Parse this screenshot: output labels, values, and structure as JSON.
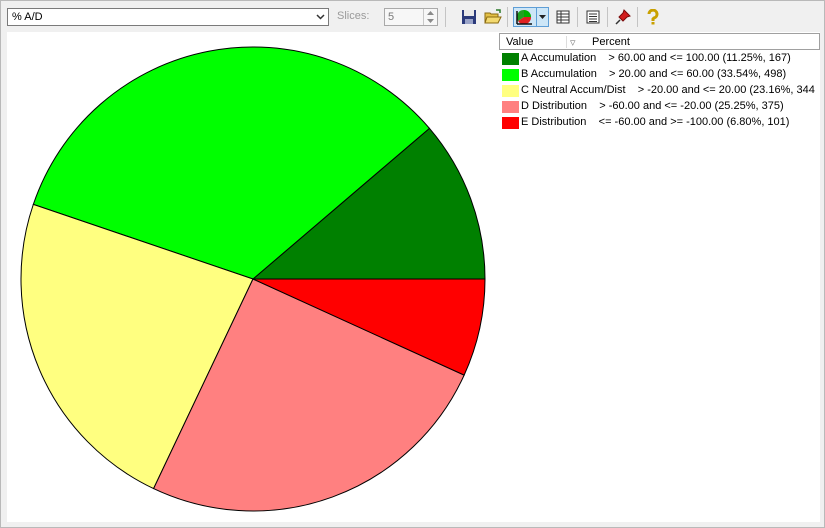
{
  "toolbar": {
    "indicator_select": "% A/D",
    "slices_label": "Slices:",
    "slices_value": "5",
    "icons": [
      "save-icon",
      "open-folder-icon",
      "pie-chart-icon",
      "dropdown-arrow-icon",
      "table-view-icon",
      "list-view-icon",
      "pin-icon",
      "help-icon"
    ]
  },
  "legend": {
    "header_value": "Value",
    "header_percent": "Percent"
  },
  "chart_data": {
    "type": "pie",
    "slices": [
      {
        "label": "A Accumulation",
        "range": "> 60.00 and <= 100.00",
        "percent": 11.25,
        "count": 167,
        "color": "#008000",
        "text": "A Accumulation    > 60.00 and <= 100.00 (11.25%, 167)"
      },
      {
        "label": "B Accumulation",
        "range": "> 20.00 and <= 60.00",
        "percent": 33.54,
        "count": 498,
        "color": "#00ff00",
        "text": "B Accumulation    > 20.00 and <= 60.00 (33.54%, 498)"
      },
      {
        "label": "C Neutral Accum/Dist",
        "range": "> -20.00 and <= 20.00",
        "percent": 23.16,
        "count": 344,
        "color": "#ffff80",
        "text": "C Neutral Accum/Dist    > -20.00 and <= 20.00 (23.16%, 344"
      },
      {
        "label": "D Distribution",
        "range": "> -60.00 and <= -20.00",
        "percent": 25.25,
        "count": 375,
        "color": "#ff8080",
        "text": "D Distribution    > -60.00 and <= -20.00 (25.25%, 375)"
      },
      {
        "label": "E Distribution",
        "range": "<= -60.00 and >= -100.00",
        "percent": 6.8,
        "count": 101,
        "color": "#ff0000",
        "text": "E Distribution    <= -60.00 and >= -100.00 (6.80%, 101)"
      }
    ]
  }
}
